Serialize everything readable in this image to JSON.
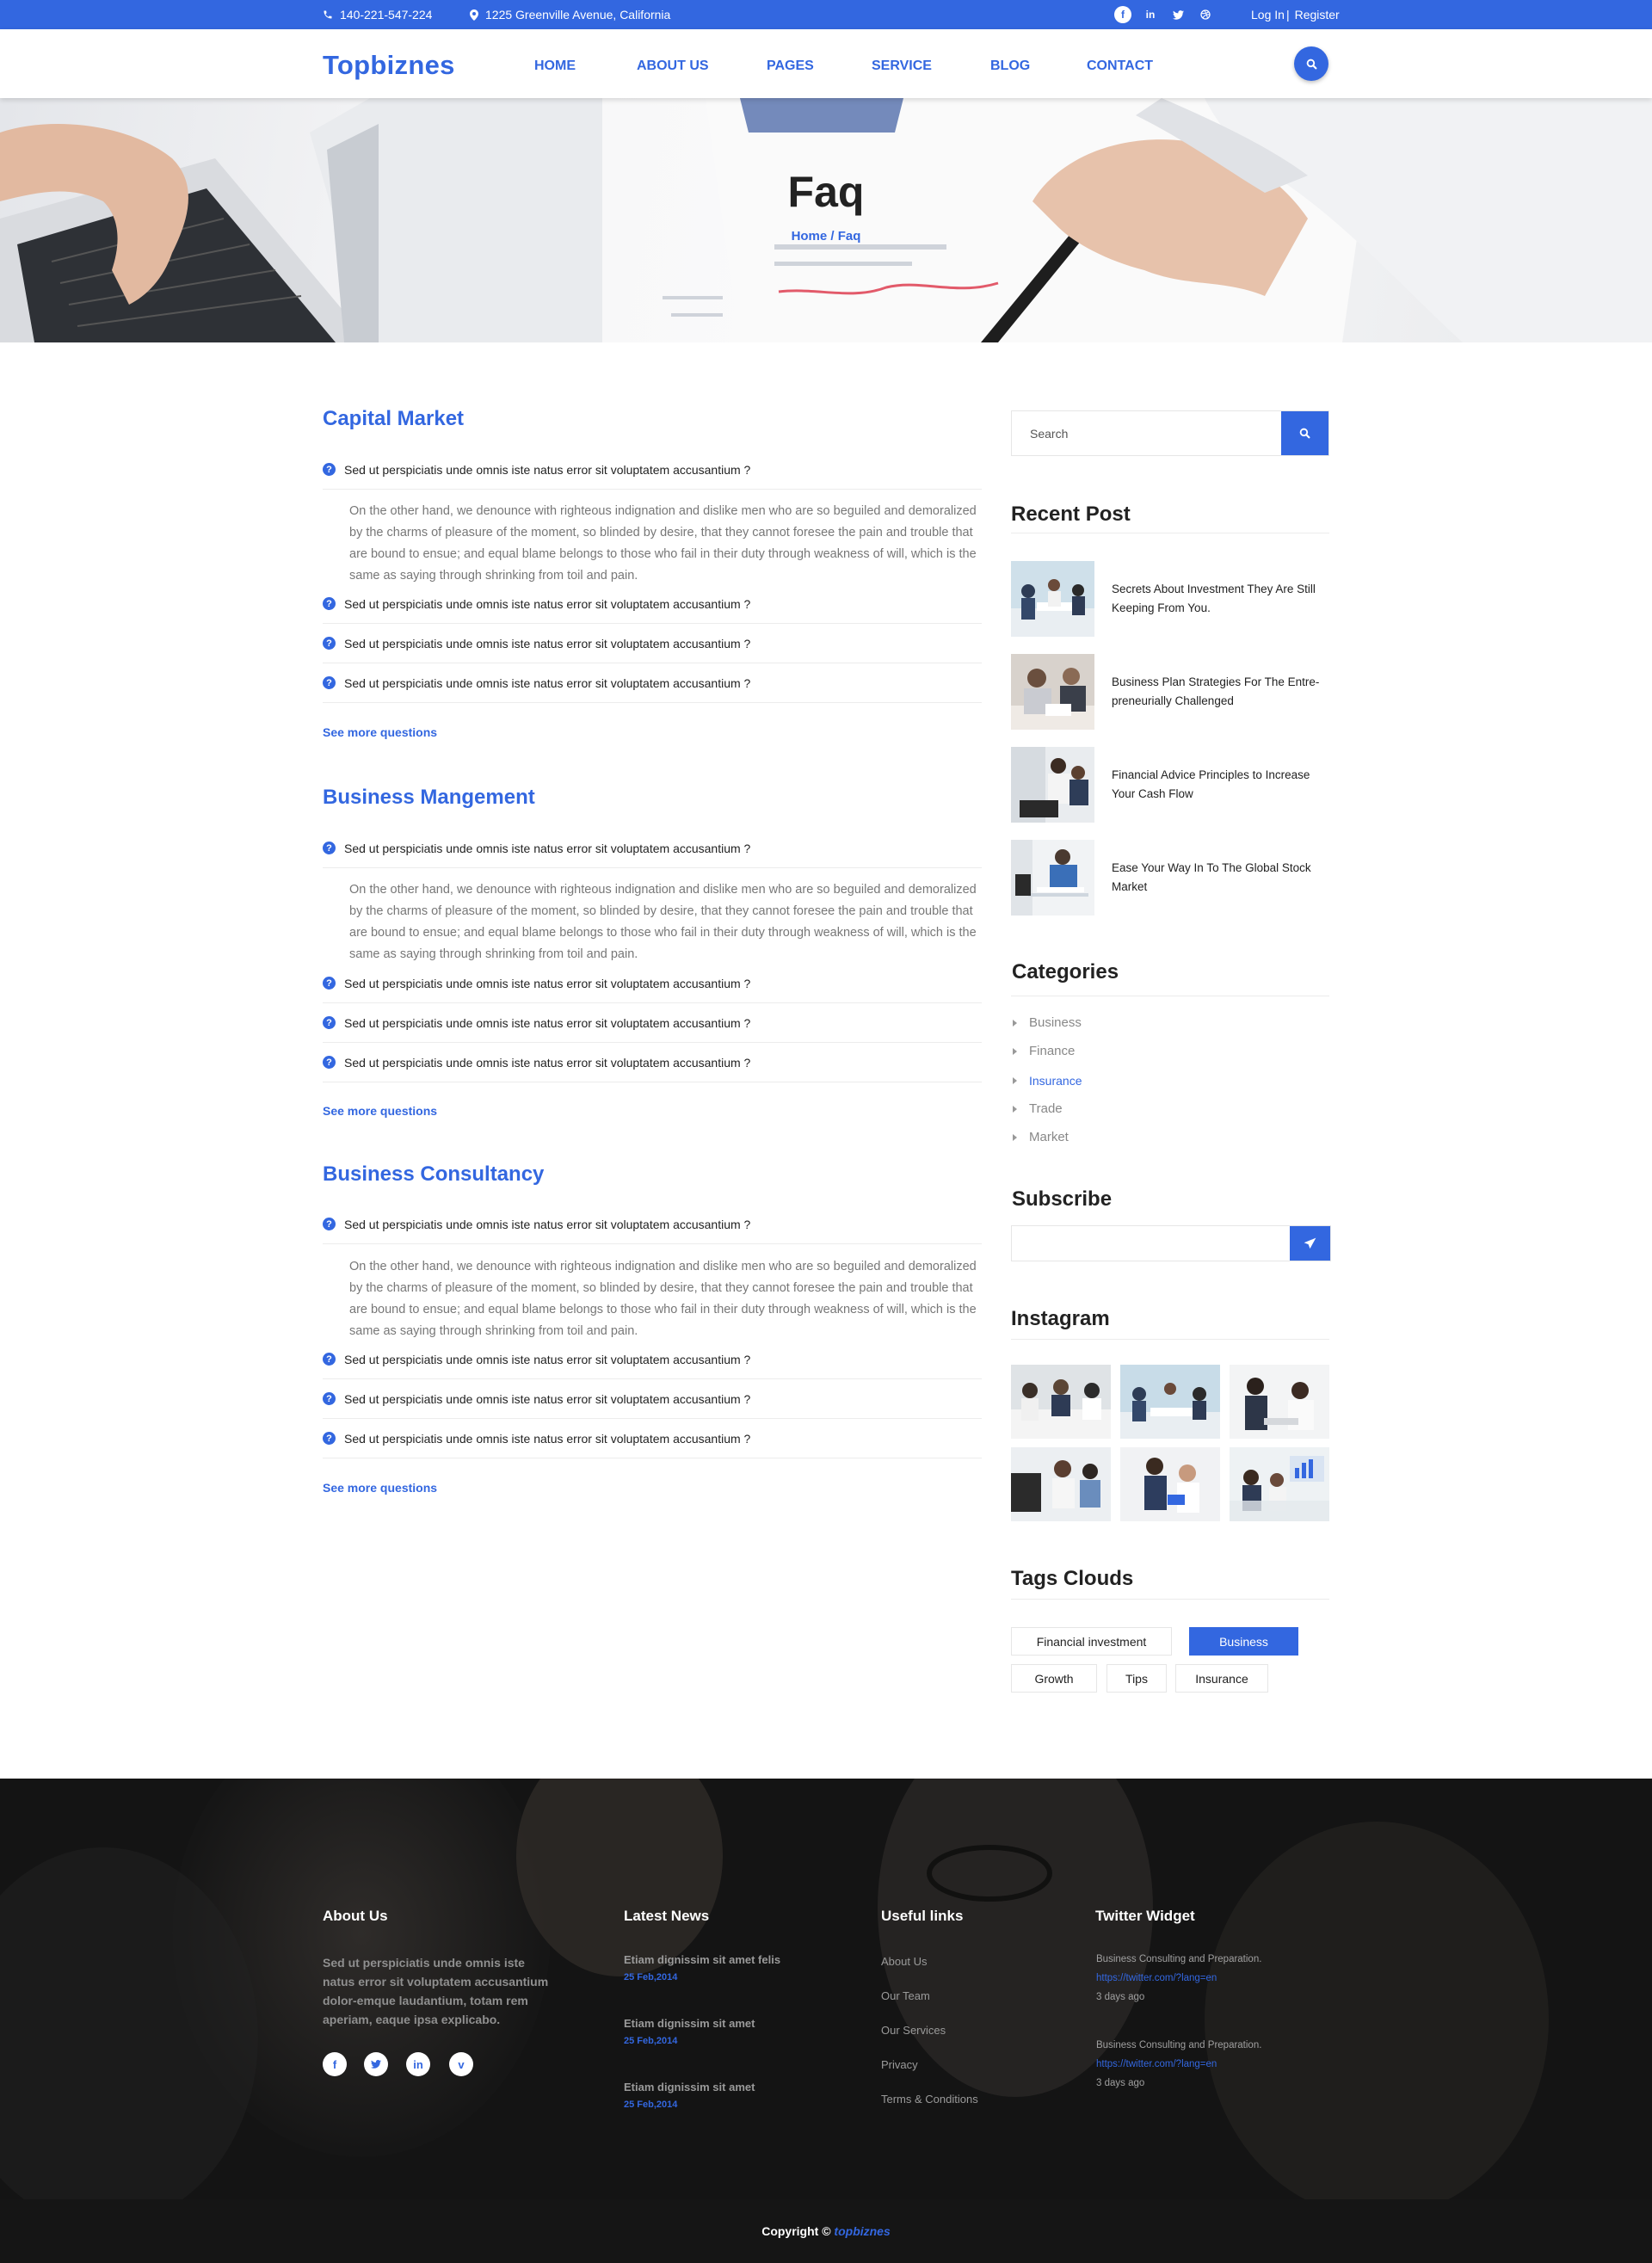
{
  "topbar": {
    "phone": "140-221-547-224",
    "address": "1225 Greenville Avenue, California",
    "socials": [
      "facebook-icon",
      "linkedin-icon",
      "twitter-icon",
      "dribbble-icon"
    ],
    "login": "Log In",
    "separator": "|",
    "register": "Register"
  },
  "header": {
    "logo": "Topbiznes",
    "nav": [
      "HOME",
      "ABOUT US",
      "PAGES",
      "SERVICE",
      "BLOG",
      "CONTACT"
    ]
  },
  "hero": {
    "title": "Faq",
    "breadcrumb": "Home / Faq"
  },
  "faq": {
    "question": "Sed ut perspiciatis unde omnis iste natus error sit voluptatem accusantium ?",
    "answer": "On the other hand, we denounce with righteous indignation and dislike men who are so beguiled and demoralized by the charms of pleasure of the moment, so blinded by desire, that they cannot foresee the pain and trouble that are bound to ensue; and equal blame belongs to those who fail in their duty through weakness of will, which is the same as saying through shrinking from toil and pain.",
    "see_more": "See more questions",
    "sections": [
      {
        "title": "Capital Market"
      },
      {
        "title": "Business Mangement"
      },
      {
        "title": "Business Consultancy"
      }
    ]
  },
  "sidebar": {
    "search_placeholder": "Search",
    "recent_title": "Recent Post",
    "recent_posts": [
      "Secrets About Investment They Are Still Keeping From You.",
      "Business Plan Strategies For The Entre-preneurially Challenged",
      "Financial Advice Principles to Increase Your Cash Flow",
      "Ease Your Way In To The Global Stock Market"
    ],
    "categories_title": "Categories",
    "categories": [
      "Business",
      "Finance",
      "Insurance",
      "Trade",
      "Market"
    ],
    "active_category": "Insurance",
    "subscribe_title": "Subscribe",
    "instagram_title": "Instagram",
    "tags_title": "Tags Clouds",
    "tags": [
      "Financial investment",
      "Business",
      "Growth",
      "Tips",
      "Insurance"
    ],
    "active_tag": "Business"
  },
  "footer": {
    "about_title": "About Us",
    "about_text": "Sed ut perspiciatis unde omnis iste natus error sit voluptatem accusantium dolor-emque laudantium, totam rem aperiam, eaque ipsa  explicabo.",
    "about_socials": [
      "facebook-icon",
      "twitter-icon",
      "linkedin-icon",
      "vimeo-icon"
    ],
    "news_title": "Latest News",
    "news": [
      {
        "title": "Etiam dignissim sit amet felis",
        "date": "25 Feb,2014"
      },
      {
        "title": "Etiam dignissim sit amet",
        "date": "25 Feb,2014"
      },
      {
        "title": "Etiam dignissim sit amet",
        "date": "25 Feb,2014"
      }
    ],
    "links_title": "Useful links",
    "links": [
      "About Us",
      "Our Team",
      "Our Services",
      "Privacy",
      "Terms & Conditions"
    ],
    "twitter_title": "Twitter Widget",
    "tweets": [
      {
        "text": "Business Consulting and Preparation.",
        "link": "https://twitter.com/?lang=en",
        "time": "3 days ago"
      },
      {
        "text": "Business Consulting and Preparation.",
        "link": "https://twitter.com/?lang=en",
        "time": "3 days ago"
      }
    ],
    "copyright_prefix": "Copyright ©",
    "copyright_brand": "topbiznes"
  },
  "colors": {
    "accent": "#3367e0",
    "footer_bg": "#151515"
  }
}
